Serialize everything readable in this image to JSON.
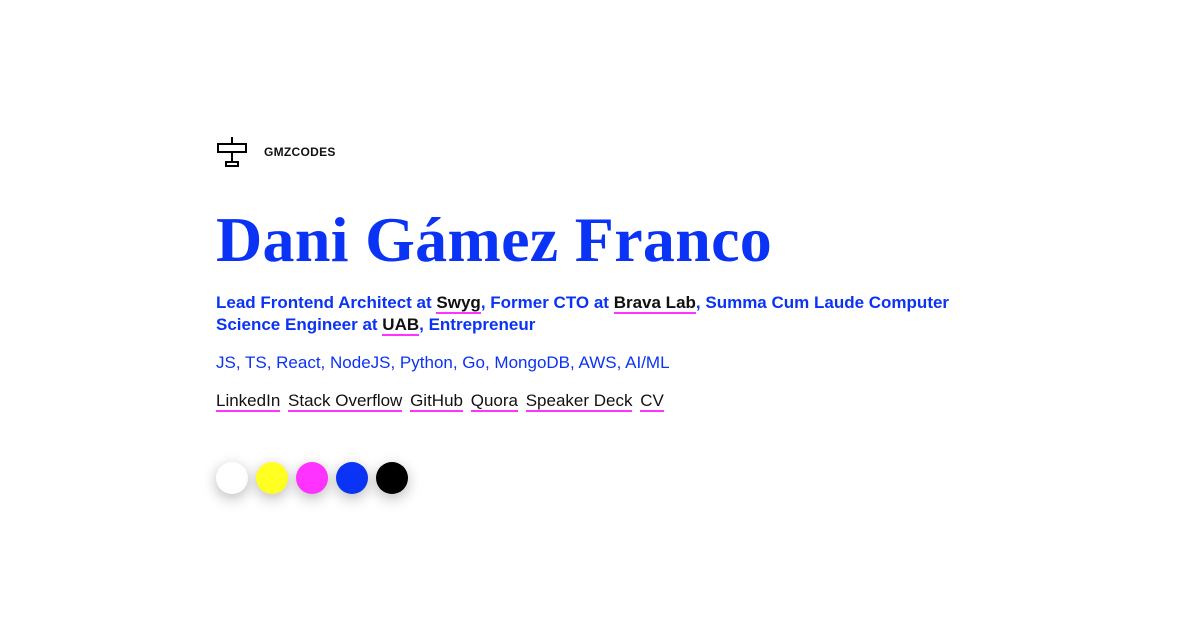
{
  "brand": {
    "name": "GMZCODES",
    "logo_icon": "plane-icon"
  },
  "title": "Dani Gámez Franco",
  "bio": {
    "p1": "Lead Frontend Architect at ",
    "swyg": "Swyg",
    "p2": ", Former CTO at ",
    "brava": "Brava Lab",
    "p3": ", Summa Cum Laude Computer Science Engineer at ",
    "uab": "UAB",
    "p4": ", Entrepreneur"
  },
  "skills": "JS, TS, React, NodeJS, Python, Go, MongoDB, AWS, AI/ML",
  "links": [
    "LinkedIn",
    "Stack Overflow",
    "GitHub",
    "Quora",
    "Speaker Deck",
    "CV"
  ],
  "palette": [
    "#ffffff",
    "#ffff22",
    "#ff33ff",
    "#0a33f5",
    "#000000"
  ],
  "colors": {
    "accent": "#0a33f5",
    "underline": "#ff33ff",
    "text": "#111111"
  }
}
